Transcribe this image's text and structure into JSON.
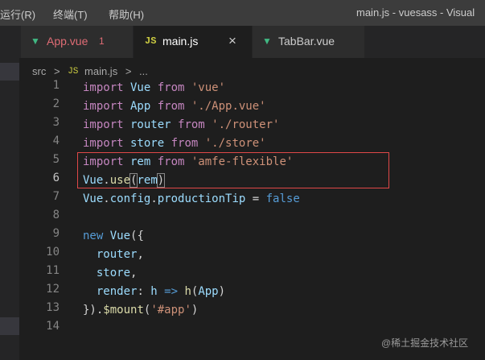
{
  "menu": [
    "运行(R)",
    "终端(T)",
    "帮助(H)"
  ],
  "window_title": "main.js - vuesass - Visual",
  "tabs": [
    {
      "label": "App.vue",
      "badge": "1",
      "icon": "vue-icon",
      "label_color": "#e06c75"
    },
    {
      "label": "main.js",
      "icon": "js-icon",
      "close": "×",
      "active": true
    },
    {
      "label": "TabBar.vue",
      "icon": "vue-icon"
    }
  ],
  "breadcrumb": {
    "folder": "src",
    "sep": ">",
    "file_icon": "JS",
    "file": "main.js",
    "sep2": ">",
    "rest": "..."
  },
  "line_numbers": [
    "1",
    "2",
    "3",
    "4",
    "5",
    "6",
    "7",
    "8",
    "9",
    "10",
    "11",
    "12",
    "13",
    "14"
  ],
  "current_line": "6",
  "code": {
    "l1": {
      "kw": "import",
      "name": " Vue ",
      "from": "from",
      "src": " 'vue'"
    },
    "l2": {
      "kw": "import",
      "name": " App ",
      "from": "from",
      "src": " './App.vue'"
    },
    "l3": {
      "kw": "import",
      "name": " router ",
      "from": "from",
      "src": " './router'"
    },
    "l4": {
      "kw": "import",
      "name": " store ",
      "from": "from",
      "src": " './store'"
    },
    "l5": {
      "kw": "import",
      "name": " rem ",
      "from": "from",
      "src": " 'amfe-flexible'"
    },
    "l6": {
      "obj": "Vue",
      "dot": ".",
      "method": "use",
      "open": "(",
      "arg": "rem",
      "close": ")"
    },
    "l7": {
      "obj": "Vue",
      "dot": ".",
      "p1": "config",
      "dot2": ".",
      "p2": "productionTip",
      "eq": " = ",
      "val": "false"
    },
    "l9": {
      "kw": "new",
      "cls": " Vue",
      "open": "({"
    },
    "l10": {
      "prop": "  router",
      "comma": ","
    },
    "l11": {
      "prop": "  store",
      "comma": ","
    },
    "l12": {
      "prop": "  render",
      "colon": ": ",
      "param": "h",
      "arrow": " => ",
      "call": "h",
      "open": "(",
      "arg": "App",
      "close": ")"
    },
    "l13": {
      "close": "}).",
      "method": "$mount",
      "open": "(",
      "str": "'#app'",
      "close2": ")"
    }
  },
  "watermark": "@稀土掘金技术社区",
  "colors": {
    "background": "#1e1e1e",
    "keyword": "#c586c0",
    "string": "#ce9178",
    "identifier": "#9cdcfe",
    "function": "#dcdcaa",
    "boolean": "#569cd6",
    "highlight_border": "#e04848"
  }
}
